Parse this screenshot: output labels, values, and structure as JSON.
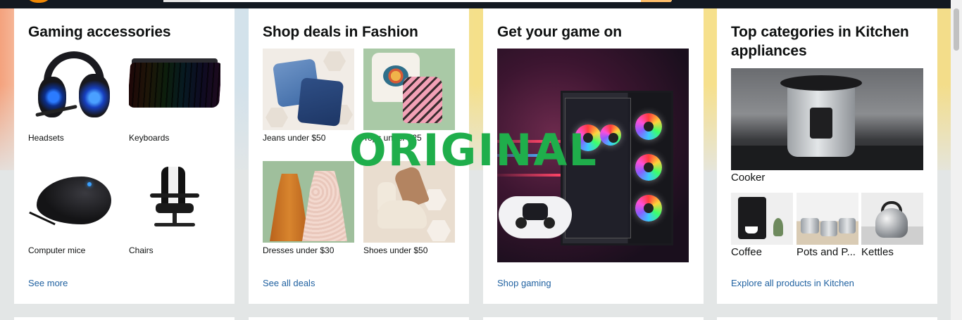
{
  "nav": {
    "logo_icon": "amazon-logo-icon",
    "search_icon": "search-icon"
  },
  "cards": {
    "gaming": {
      "title": "Gaming accessories",
      "items": [
        {
          "label": "Headsets",
          "icon": "headset-image"
        },
        {
          "label": "Keyboards",
          "icon": "keyboard-image"
        },
        {
          "label": "Computer mice",
          "icon": "mouse-image"
        },
        {
          "label": "Chairs",
          "icon": "chair-image"
        }
      ],
      "link": "See more"
    },
    "fashion": {
      "title": "Shop deals in Fashion",
      "items": [
        {
          "label": "Jeans under $50",
          "icon": "jeans-image"
        },
        {
          "label": "Tops under $25",
          "icon": "tops-image"
        },
        {
          "label": "Dresses under $30",
          "icon": "dress-image"
        },
        {
          "label": "Shoes under $50",
          "icon": "shoes-image"
        }
      ],
      "link": "See all deals"
    },
    "game": {
      "title": "Get your game on",
      "image": "gaming-pc-image",
      "link": "Shop gaming"
    },
    "kitchen": {
      "title": "Top categories in Kitchen appliances",
      "main": {
        "label": "Cooker",
        "icon": "pressure-cooker-image"
      },
      "items": [
        {
          "label": "Coffee",
          "icon": "coffee-machine-image"
        },
        {
          "label": "Pots and P...",
          "icon": "pots-image"
        },
        {
          "label": "Kettles",
          "icon": "kettle-image"
        }
      ],
      "link": "Explore all products in Kitchen"
    }
  },
  "overlay": {
    "watermark": "ORIGINAL"
  },
  "colors": {
    "link": "#2162a1",
    "nav_bg": "#131921",
    "page_bg": "#e3e6e6",
    "watermark": "#1fae4b"
  }
}
